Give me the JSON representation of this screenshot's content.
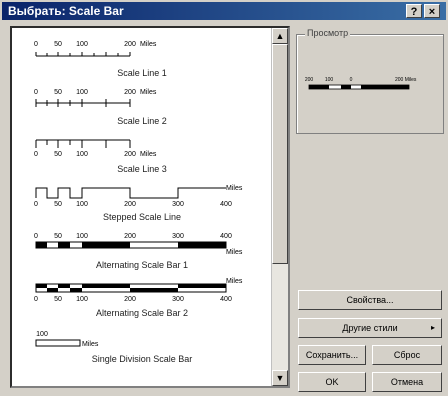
{
  "window": {
    "title": "Выбрать: Scale Bar",
    "help_btn": "?",
    "close_btn": "×"
  },
  "preview": {
    "legend": "Просмотр",
    "ticks": [
      "200",
      "100",
      "0",
      "200 Miles"
    ]
  },
  "buttons": {
    "properties": "Свойства...",
    "more_styles": "Другие стили",
    "save": "Сохранить...",
    "reset": "Сброс",
    "ok": "OK",
    "cancel": "Отмена"
  },
  "list": {
    "items": [
      {
        "label": "Scale Line 1",
        "ticks": [
          "0",
          "50",
          "100",
          "200",
          "Miles"
        ]
      },
      {
        "label": "Scale Line 2",
        "ticks": [
          "0",
          "50",
          "100",
          "200",
          "Miles"
        ]
      },
      {
        "label": "Scale Line 3",
        "ticks": [
          "0",
          "50",
          "100",
          "200",
          "Miles"
        ]
      },
      {
        "label": "Stepped Scale Line",
        "ticks": [
          "0",
          "50",
          "100",
          "200",
          "300",
          "400",
          "Miles"
        ]
      },
      {
        "label": "Alternating Scale Bar 1",
        "ticks": [
          "0",
          "50",
          "100",
          "200",
          "300",
          "400",
          "Miles"
        ]
      },
      {
        "label": "Alternating Scale Bar 2",
        "ticks": [
          "0",
          "50",
          "100",
          "200",
          "300",
          "400",
          "Miles"
        ]
      },
      {
        "label": "Single Division Scale Bar",
        "ticks": [
          "100",
          "Miles"
        ]
      }
    ]
  }
}
